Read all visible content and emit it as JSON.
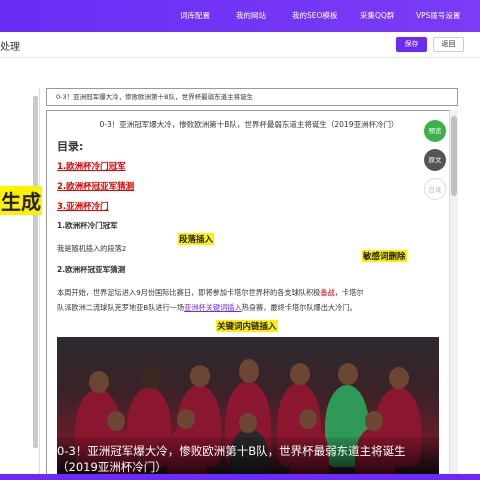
{
  "nav": [
    "词库配置",
    "我的网站",
    "我的SEO模板",
    "采集QQ群",
    "VPS拨号设置"
  ],
  "page_title": "处理",
  "buttons": {
    "save": "保存",
    "back": "返回"
  },
  "left_label": "生成",
  "title_field": "0-3！亚洲冠军爆大冷，惨败欧洲第十B队，世界杯最弱东道主将诞生",
  "article": {
    "heading": "0-3！亚洲冠军爆大冷，惨败欧洲第十B队，世界杯最弱东道主将诞生（2019亚洲杯冷门）",
    "toc_title": "目录:",
    "toc": [
      "1.欧洲杯冷门冠军",
      "2.欧洲杯冠亚军猜测",
      "3.亚洲杯冷门"
    ],
    "section1_title": "1.欧洲杯冷门冠军",
    "section1_para": "我是随机插入的段落2",
    "section2_title": "2.欧洲杯冠亚军猜测",
    "para_line1_a": "本周开始，世界足坛进入9月份国际比赛日，即将参加卡塔尔世界杯的各支球队积极",
    "para_line1_link": "备战",
    "para_line1_b": "，卡塔尔",
    "para_line2_a": "队派欧洲二流球队克罗地亚B队进行一场",
    "para_line2_link": "亚洲杯关键词插入",
    "para_line2_b": "热身赛，最终卡塔尔队爆出大冷门。",
    "caption": "0-3！亚洲冠军爆大冷，惨败欧洲第十B队，世界杯最弱东道主将诞生（2019亚洲杯冷门）"
  },
  "annotations": {
    "paragraph_insert": "段落插入",
    "sensitive_delete": "敏感词删除",
    "keyword_link_insert": "关键词内链插入"
  },
  "side_buttons": [
    "预览",
    "原文",
    "目录"
  ],
  "colors": {
    "accent": "#6a2cf5",
    "preview": "#3cb04a",
    "original": "#555555",
    "toc_button": "#cccccc",
    "link_red": "#e00000",
    "highlight": "#fff200"
  }
}
